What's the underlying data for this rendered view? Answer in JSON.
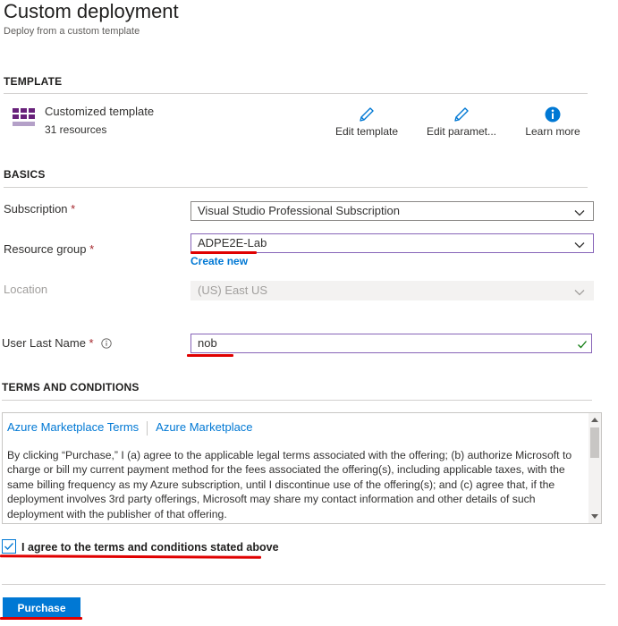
{
  "page": {
    "title": "Custom deployment",
    "subtitle": "Deploy from a custom template"
  },
  "template_section": {
    "header": "TEMPLATE",
    "name": "Customized template",
    "resources": "31 resources",
    "actions": {
      "edit_template": "Edit template",
      "edit_parameters": "Edit paramet...",
      "learn_more": "Learn more"
    }
  },
  "basics": {
    "header": "BASICS",
    "subscription": {
      "label": "Subscription",
      "required_mark": "*",
      "value": "Visual Studio Professional Subscription"
    },
    "resource_group": {
      "label": "Resource group",
      "required_mark": "*",
      "value": "ADPE2E-Lab",
      "create_new": "Create new"
    },
    "location": {
      "label": "Location",
      "value": "(US) East US"
    },
    "user_last_name": {
      "label": "User Last Name",
      "required_mark": "*",
      "value": "nob"
    }
  },
  "terms": {
    "header": "TERMS AND CONDITIONS",
    "links": [
      "Azure Marketplace Terms",
      "Azure Marketplace"
    ],
    "body": "By clicking “Purchase,” I (a) agree to the applicable legal terms associated with the offering; (b) authorize Microsoft to charge or bill my current payment method for the fees associated the offering(s), including applicable taxes, with the same billing frequency as my Azure subscription, until I discontinue use of the offering(s); and (c) agree that, if the deployment involves 3rd party offerings, Microsoft may share my contact information and other details of such deployment with the publisher of that offering.",
    "agree_label": "I agree to the terms and conditions stated above",
    "agree_checked": true
  },
  "footer": {
    "purchase_label": "Purchase"
  },
  "colors": {
    "accent": "#0078d4",
    "template_icon": "#68217a",
    "annotation_red": "#e00000",
    "valid_green": "#107c10",
    "focus_purple": "#8764b8"
  },
  "icons": {
    "template": "grid-template-icon",
    "edit": "pencil-icon",
    "info": "info-icon",
    "dropdown": "chevron-down-icon",
    "valid": "checkmark-icon"
  }
}
